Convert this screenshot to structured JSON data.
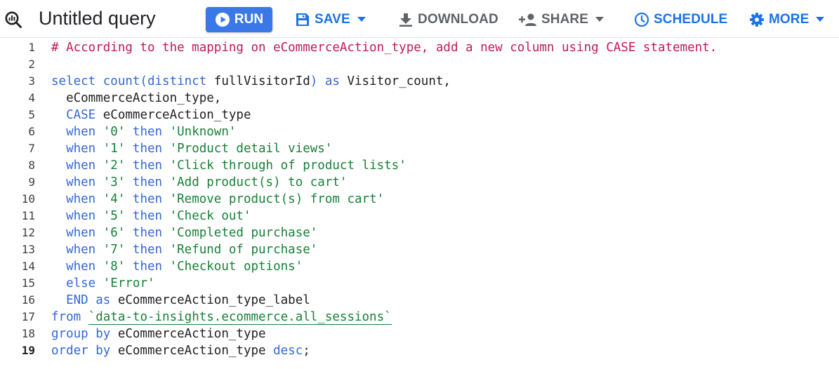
{
  "toolbar": {
    "title": "Untitled query",
    "run_label": "RUN",
    "save_label": "SAVE",
    "download_label": "DOWNLOAD",
    "share_label": "SHARE",
    "schedule_label": "SCHEDULE",
    "more_label": "MORE",
    "icons": {
      "query": "query-magnifier-icon",
      "run": "play-circle-icon",
      "save": "floppy-disk-icon",
      "download": "download-arrow-icon",
      "share": "person-add-icon",
      "schedule": "clock-icon",
      "more": "gear-icon",
      "dropdown": "caret-down-icon"
    }
  },
  "colors": {
    "run_button": "#3b78e7",
    "toolbar_blue": "#1a73e8",
    "toolbar_gray": "#5f6368",
    "comment": "#c2185b",
    "keyword": "#3367d6",
    "string": "#188038",
    "identifier": "#202124"
  },
  "editor": {
    "active_line": 19,
    "lines": [
      {
        "n": "1",
        "tokens": [
          {
            "t": "comment",
            "v": "# According to the mapping on eCommerceAction_type, add a new column using CASE statement."
          }
        ]
      },
      {
        "n": "2",
        "tokens": []
      },
      {
        "n": "3",
        "tokens": [
          {
            "t": "kw",
            "v": "select count(distinct "
          },
          {
            "t": "plain",
            "v": "fullVisitorId"
          },
          {
            "t": "kw",
            "v": ") as "
          },
          {
            "t": "plain",
            "v": "Visitor_count,"
          }
        ]
      },
      {
        "n": "4",
        "tokens": [
          {
            "t": "plain",
            "v": "  eCommerceAction_type,"
          }
        ]
      },
      {
        "n": "5",
        "tokens": [
          {
            "t": "kw",
            "v": "  CASE "
          },
          {
            "t": "plain",
            "v": "eCommerceAction_type"
          }
        ]
      },
      {
        "n": "6",
        "tokens": [
          {
            "t": "kw",
            "v": "  when "
          },
          {
            "t": "str",
            "v": "'0'"
          },
          {
            "t": "kw",
            "v": " then "
          },
          {
            "t": "str",
            "v": "'Unknown'"
          }
        ]
      },
      {
        "n": "7",
        "tokens": [
          {
            "t": "kw",
            "v": "  when "
          },
          {
            "t": "str",
            "v": "'1'"
          },
          {
            "t": "kw",
            "v": " then "
          },
          {
            "t": "str",
            "v": "'Product detail views'"
          }
        ]
      },
      {
        "n": "8",
        "tokens": [
          {
            "t": "kw",
            "v": "  when "
          },
          {
            "t": "str",
            "v": "'2'"
          },
          {
            "t": "kw",
            "v": " then "
          },
          {
            "t": "str",
            "v": "'Click through of product lists'"
          }
        ]
      },
      {
        "n": "9",
        "tokens": [
          {
            "t": "kw",
            "v": "  when "
          },
          {
            "t": "str",
            "v": "'3'"
          },
          {
            "t": "kw",
            "v": " then "
          },
          {
            "t": "str",
            "v": "'Add product(s) to cart'"
          }
        ]
      },
      {
        "n": "10",
        "tokens": [
          {
            "t": "kw",
            "v": "  when "
          },
          {
            "t": "str",
            "v": "'4'"
          },
          {
            "t": "kw",
            "v": " then "
          },
          {
            "t": "str",
            "v": "'Remove product(s) from cart'"
          }
        ]
      },
      {
        "n": "11",
        "tokens": [
          {
            "t": "kw",
            "v": "  when "
          },
          {
            "t": "str",
            "v": "'5'"
          },
          {
            "t": "kw",
            "v": " then "
          },
          {
            "t": "str",
            "v": "'Check out'"
          }
        ]
      },
      {
        "n": "12",
        "tokens": [
          {
            "t": "kw",
            "v": "  when "
          },
          {
            "t": "str",
            "v": "'6'"
          },
          {
            "t": "kw",
            "v": " then "
          },
          {
            "t": "str",
            "v": "'Completed purchase'"
          }
        ]
      },
      {
        "n": "13",
        "tokens": [
          {
            "t": "kw",
            "v": "  when "
          },
          {
            "t": "str",
            "v": "'7'"
          },
          {
            "t": "kw",
            "v": " then "
          },
          {
            "t": "str",
            "v": "'Refund of purchase'"
          }
        ]
      },
      {
        "n": "14",
        "tokens": [
          {
            "t": "kw",
            "v": "  when "
          },
          {
            "t": "str",
            "v": "'8'"
          },
          {
            "t": "kw",
            "v": " then "
          },
          {
            "t": "str",
            "v": "'Checkout options'"
          }
        ]
      },
      {
        "n": "15",
        "tokens": [
          {
            "t": "kw",
            "v": "  else "
          },
          {
            "t": "str",
            "v": "'Error'"
          }
        ]
      },
      {
        "n": "16",
        "tokens": [
          {
            "t": "kw",
            "v": "  END as "
          },
          {
            "t": "plain",
            "v": "eCommerceAction_type_label"
          }
        ]
      },
      {
        "n": "17",
        "tokens": [
          {
            "t": "kw",
            "v": "from "
          },
          {
            "t": "ref",
            "v": "`data-to-insights.ecommerce.all_sessions`"
          }
        ]
      },
      {
        "n": "18",
        "tokens": [
          {
            "t": "kw",
            "v": "group by "
          },
          {
            "t": "plain",
            "v": "eCommerceAction_type"
          }
        ]
      },
      {
        "n": "19",
        "tokens": [
          {
            "t": "kw",
            "v": "order by "
          },
          {
            "t": "plain",
            "v": "eCommerceAction_type "
          },
          {
            "t": "kw",
            "v": "desc"
          },
          {
            "t": "plain",
            "v": ";"
          }
        ]
      }
    ]
  }
}
